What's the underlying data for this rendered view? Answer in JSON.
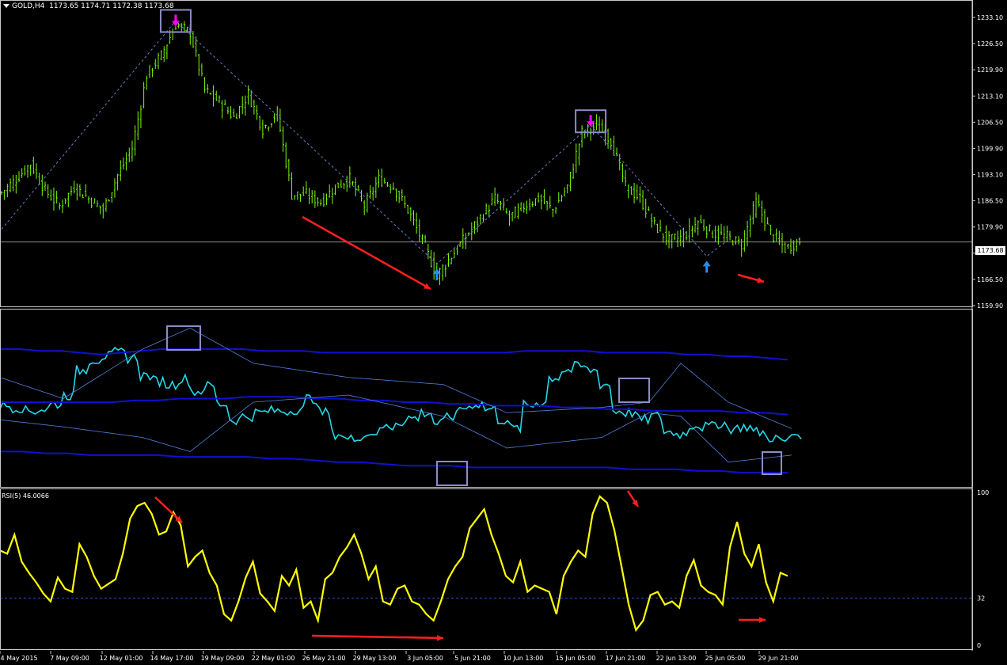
{
  "header": {
    "symbol": "GOLD,H4",
    "ohlc": "1173.65 1174.71 1172.38 1173.68"
  },
  "current_price_label": "1173.68",
  "colors": {
    "background": "#000000",
    "candles": "#7CFC00",
    "zigzag": "#6080C0",
    "annotation_arrows": "#FF2020",
    "highlight_boxes": "#8C8CC8",
    "sell_arrow": "#FF00FF",
    "buy_arrow": "#1E90FF",
    "osc_line": "#22D8E8",
    "bands_outer": "#1010D0",
    "bands_inner": "#5080E0",
    "rsi_line": "#FFFF00",
    "rsi_level": "#3050C0"
  },
  "x_axis_labels": [
    "4 May 2015",
    "7 May 09:00",
    "12 May 01:00",
    "14 May 17:00",
    "19 May 09:00",
    "22 May 01:00",
    "26 May 21:00",
    "29 May 13:00",
    "3 Jun 05:00",
    "5 Jun 21:00",
    "10 Jun 13:00",
    "15 Jun 05:00",
    "17 Jun 21:00",
    "22 Jun 13:00",
    "25 Jun 05:00",
    "29 Jun 21:00"
  ],
  "price_axis_labels": [
    "1233.10",
    "1226.50",
    "1219.90",
    "1213.10",
    "1206.50",
    "1199.90",
    "1193.10",
    "1186.50",
    "1179.90",
    "1173.60",
    "1166.50",
    "1159.90"
  ],
  "rsi_panel": {
    "title": "RSI(5) 46.0066",
    "levels": [
      "100",
      "32",
      "0"
    ]
  },
  "chart_data": [
    {
      "type": "line",
      "panel": "price",
      "symbol": "GOLD,H4",
      "ylim": [
        1157,
        1236
      ],
      "current_price": 1173.68,
      "x_labels": [
        "4 May 2015",
        "7 May 09:00",
        "12 May 01:00",
        "14 May 17:00",
        "19 May 09:00",
        "22 May 01:00",
        "26 May 21:00",
        "29 May 13:00",
        "3 Jun 05:00",
        "5 Jun 21:00",
        "10 Jun 13:00",
        "15 Jun 05:00",
        "17 Jun 21:00",
        "22 Jun 13:00",
        "25 Jun 05:00",
        "29 Jun 21:00"
      ],
      "bar_count": 230,
      "price_path_anchors": [
        [
          0,
          1186.5
        ],
        [
          5,
          1190
        ],
        [
          10,
          1194
        ],
        [
          15,
          1187
        ],
        [
          20,
          1183
        ],
        [
          25,
          1188
        ],
        [
          30,
          1185
        ],
        [
          35,
          1182
        ],
        [
          40,
          1191
        ],
        [
          45,
          1198
        ],
        [
          50,
          1217
        ],
        [
          55,
          1222
        ],
        [
          60,
          1230
        ],
        [
          65,
          1228
        ],
        [
          70,
          1213
        ],
        [
          75,
          1210
        ],
        [
          80,
          1206
        ],
        [
          85,
          1212
        ],
        [
          90,
          1203
        ],
        [
          95,
          1207
        ],
        [
          100,
          1186
        ],
        [
          105,
          1186
        ],
        [
          110,
          1184
        ],
        [
          115,
          1188
        ],
        [
          120,
          1190
        ],
        [
          125,
          1183
        ],
        [
          130,
          1190
        ],
        [
          135,
          1188
        ],
        [
          140,
          1182
        ],
        [
          145,
          1174
        ],
        [
          150,
          1165
        ],
        [
          155,
          1170
        ],
        [
          160,
          1175
        ],
        [
          165,
          1180
        ],
        [
          170,
          1185
        ],
        [
          175,
          1180
        ],
        [
          180,
          1183
        ],
        [
          185,
          1185
        ],
        [
          190,
          1182
        ],
        [
          195,
          1188
        ],
        [
          200,
          1202
        ],
        [
          205,
          1204
        ],
        [
          210,
          1200
        ],
        [
          215,
          1188
        ],
        [
          220,
          1185
        ],
        [
          225,
          1178
        ],
        [
          230,
          1174
        ],
        [
          235,
          1175
        ],
        [
          240,
          1179
        ],
        [
          245,
          1176
        ],
        [
          250,
          1175
        ],
        [
          255,
          1173
        ],
        [
          260,
          1184
        ],
        [
          265,
          1176
        ],
        [
          270,
          1172
        ],
        [
          275,
          1174
        ]
      ],
      "zigzag": [
        [
          0,
          1177
        ],
        [
          60,
          1231
        ],
        [
          150,
          1168
        ],
        [
          203,
          1204
        ],
        [
          243,
          1170
        ],
        [
          250,
          1174
        ]
      ],
      "sell_arrows": [
        [
          60,
          1232
        ],
        [
          203,
          1206
        ]
      ],
      "buy_arrows": [
        [
          150,
          1166
        ],
        [
          243,
          1168
        ]
      ]
    },
    {
      "type": "line",
      "panel": "oscillator",
      "ylim": [
        0,
        100
      ],
      "series": [
        {
          "values": [
            46,
            45,
            43,
            44,
            47,
            52,
            66,
            72,
            74,
            76,
            73,
            63,
            60,
            58,
            61,
            54,
            57,
            47,
            38,
            40,
            42,
            43,
            43,
            44,
            50,
            42,
            30,
            27,
            29,
            31,
            34,
            37,
            39,
            42,
            36,
            40,
            45,
            47,
            44,
            38,
            33,
            46,
            48,
            62,
            66,
            68,
            66,
            58,
            43,
            42,
            38,
            40,
            31,
            30,
            35,
            34,
            36,
            33,
            34,
            31,
            28,
            26,
            30
          ]
        },
        {
          "values": [
            78,
            78,
            77,
            77,
            76,
            75,
            76,
            77,
            78,
            78,
            78,
            78,
            78,
            77,
            77,
            77,
            76,
            76,
            76,
            76,
            76,
            76,
            76,
            76,
            76,
            76,
            77,
            77,
            77,
            77,
            76,
            76,
            76,
            76,
            75,
            75,
            74,
            74,
            73,
            72
          ]
        },
        {
          "values": [
            48,
            48,
            48,
            48,
            48,
            48,
            49,
            49,
            50,
            50,
            50,
            51,
            51,
            51,
            50,
            50,
            49,
            49,
            48,
            48,
            47,
            47,
            46,
            46,
            46,
            45,
            45,
            44,
            44,
            43,
            43,
            43,
            43,
            42,
            42,
            41
          ]
        },
        {
          "values": [
            20,
            20,
            19,
            19,
            18,
            18,
            18,
            18,
            17,
            17,
            17,
            17,
            16,
            16,
            15,
            14,
            14,
            13,
            12,
            12,
            12,
            11,
            11,
            11,
            11,
            11,
            11,
            11,
            10,
            10,
            10,
            9,
            9,
            8,
            8,
            8
          ]
        }
      ]
    },
    {
      "type": "line",
      "panel": "rsi",
      "title": "RSI(5) 46.0066",
      "ylim": [
        0,
        100
      ],
      "levels": [
        32
      ],
      "series": [
        {
          "name": "RSI(5)",
          "values": [
            62,
            60,
            72,
            55,
            48,
            42,
            35,
            30,
            45,
            38,
            36,
            66,
            58,
            46,
            38,
            41,
            44,
            60,
            82,
            90,
            92,
            85,
            72,
            74,
            86,
            78,
            52,
            58,
            62,
            48,
            40,
            22,
            18,
            30,
            45,
            55,
            35,
            30,
            24,
            46,
            40,
            50,
            26,
            30,
            18,
            44,
            48,
            58,
            64,
            72,
            60,
            44,
            52,
            30,
            28,
            38,
            40,
            30,
            28,
            22,
            18,
            30,
            44,
            52,
            58,
            76,
            82,
            88,
            72,
            60,
            46,
            42,
            55,
            36,
            40,
            38,
            36,
            22,
            46,
            55,
            62,
            58,
            85,
            96,
            92,
            75,
            52,
            28,
            12,
            18,
            34,
            36,
            28,
            30,
            26,
            46,
            56,
            40,
            36,
            34,
            28,
            64,
            80,
            60,
            52,
            66,
            42,
            30,
            48,
            46
          ]
        }
      ]
    }
  ]
}
